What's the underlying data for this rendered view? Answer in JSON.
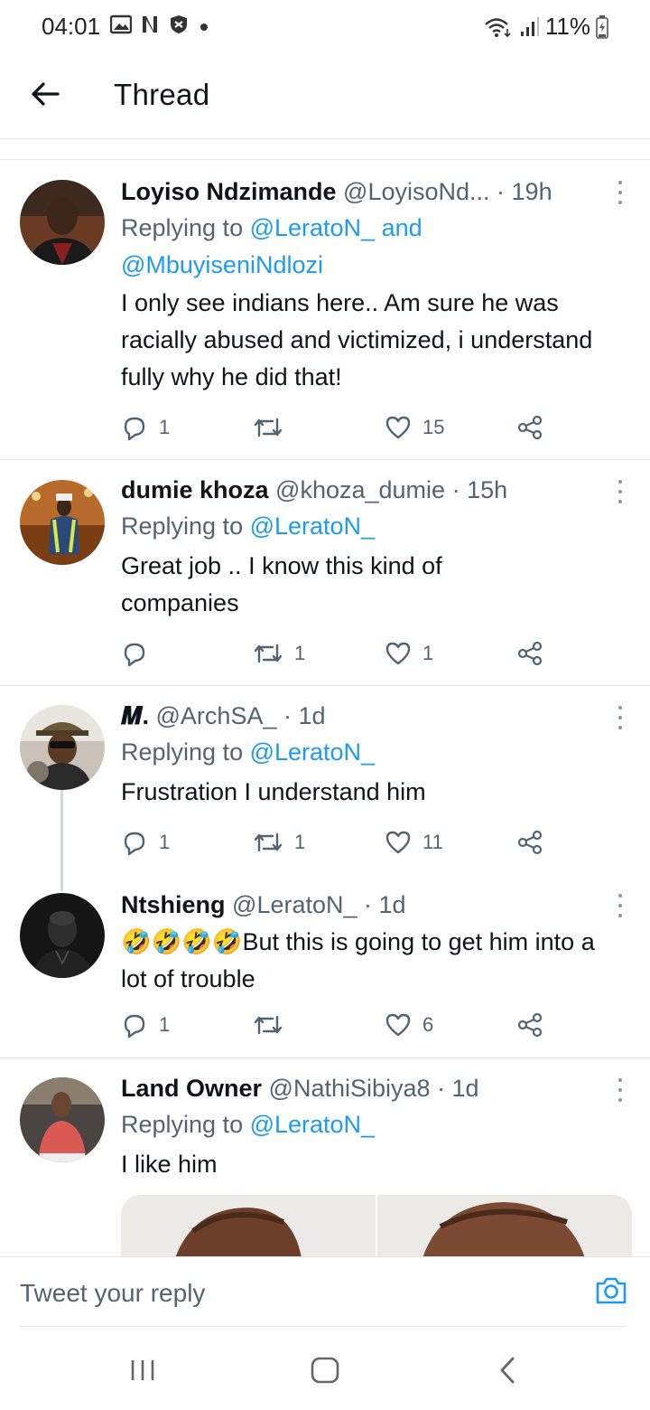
{
  "status_bar": {
    "time": "04:01",
    "battery": "11%"
  },
  "header": {
    "title": "Thread"
  },
  "tweets": [
    {
      "name": "Loyiso Ndzimande",
      "handle": "@LoyisoNd...",
      "time": "· 19h",
      "replying_prefix": "Replying to ",
      "replying_to": "@LeratoN_ and @MbuyiseniNdlozi",
      "text": "I only see indians here.. Am sure he was racially abused and victimized, i understand fully why he did that!",
      "replies": "1",
      "retweets": "",
      "likes": "15"
    },
    {
      "name": "dumie khoza",
      "handle": "@khoza_dumie",
      "time": "· 15h",
      "replying_prefix": "Replying to ",
      "replying_to": "@LeratoN_",
      "text": "Great job .. I know this kind of companies",
      "replies": "",
      "retweets": "1",
      "likes": "1"
    },
    {
      "name": "𝑴.",
      "handle": "@ArchSA_",
      "time": "· 1d",
      "replying_prefix": "Replying to ",
      "replying_to": "@LeratoN_",
      "text": "Frustration I understand him",
      "replies": "1",
      "retweets": "1",
      "likes": "11"
    },
    {
      "name": "Ntshieng",
      "handle": "@LeratoN_",
      "time": "· 1d",
      "emoji": "🤣🤣🤣🤣",
      "text": "But this is going to get him into a lot of trouble",
      "replies": "1",
      "retweets": "",
      "likes": "6"
    },
    {
      "name": "Land Owner",
      "handle": "@NathiSibiya8",
      "time": "· 1d",
      "replying_prefix": "Replying to ",
      "replying_to": "@LeratoN_",
      "text": "I like him"
    }
  ],
  "reply_bar": {
    "placeholder": "Tweet your reply"
  },
  "icons": {
    "back": "arrow-left-icon",
    "more": "more-vertical-icon",
    "reply": "reply-icon",
    "retweet": "retweet-icon",
    "like": "heart-icon",
    "share": "share-icon",
    "camera": "camera-icon"
  },
  "colors": {
    "mention": "#1d9bf0",
    "muted": "#536471",
    "text": "#0f1419"
  }
}
